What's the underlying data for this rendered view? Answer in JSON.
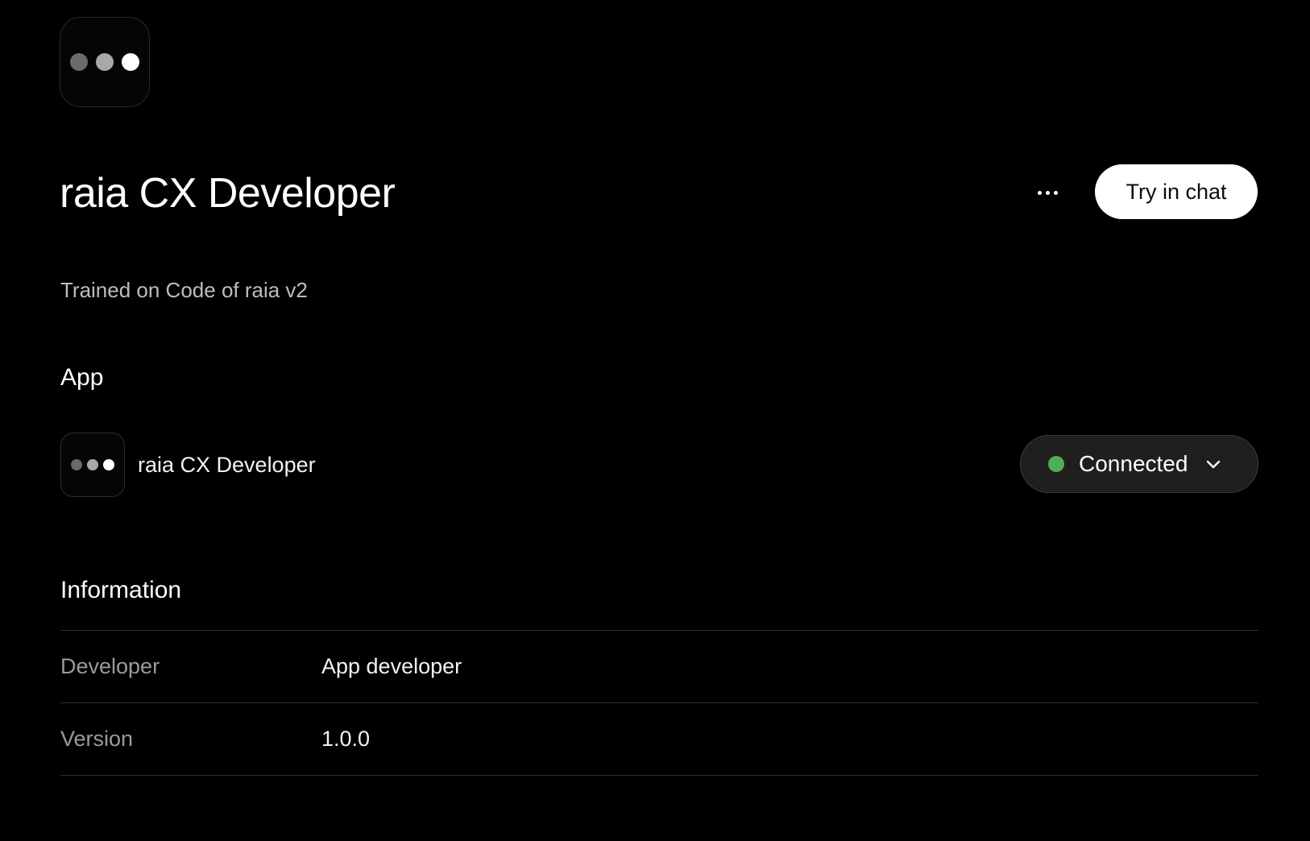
{
  "app": {
    "title": "raia CX Developer",
    "subtitle": "Trained on Code of raia v2",
    "logo_icon": "three-dots-logo-icon"
  },
  "header": {
    "more_icon": "ellipsis-icon",
    "try_button_label": "Try in chat"
  },
  "app_section": {
    "heading": "App",
    "item": {
      "name": "raia CX Developer",
      "status_label": "Connected",
      "status_color": "#4caf50",
      "chevron_icon": "chevron-down-icon"
    }
  },
  "information": {
    "heading": "Information",
    "rows": [
      {
        "label": "Developer",
        "value": "App developer"
      },
      {
        "label": "Version",
        "value": "1.0.0"
      }
    ]
  },
  "colors": {
    "background": "#000000",
    "primary_text": "#ffffff",
    "muted_text": "#9a9a9a",
    "divider": "#2e2e2e",
    "status_green": "#4caf50"
  }
}
